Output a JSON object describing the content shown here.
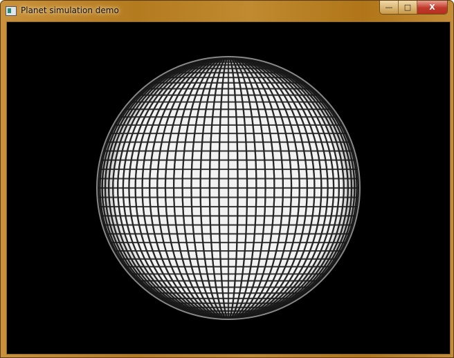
{
  "window": {
    "title": "Planet simulation demo"
  },
  "controls": {
    "minimize": "—",
    "maximize": "□",
    "close": "X"
  },
  "scene": {
    "background": "#000000",
    "planet_color": "#f2f2f2",
    "grid_color": "#222222"
  }
}
